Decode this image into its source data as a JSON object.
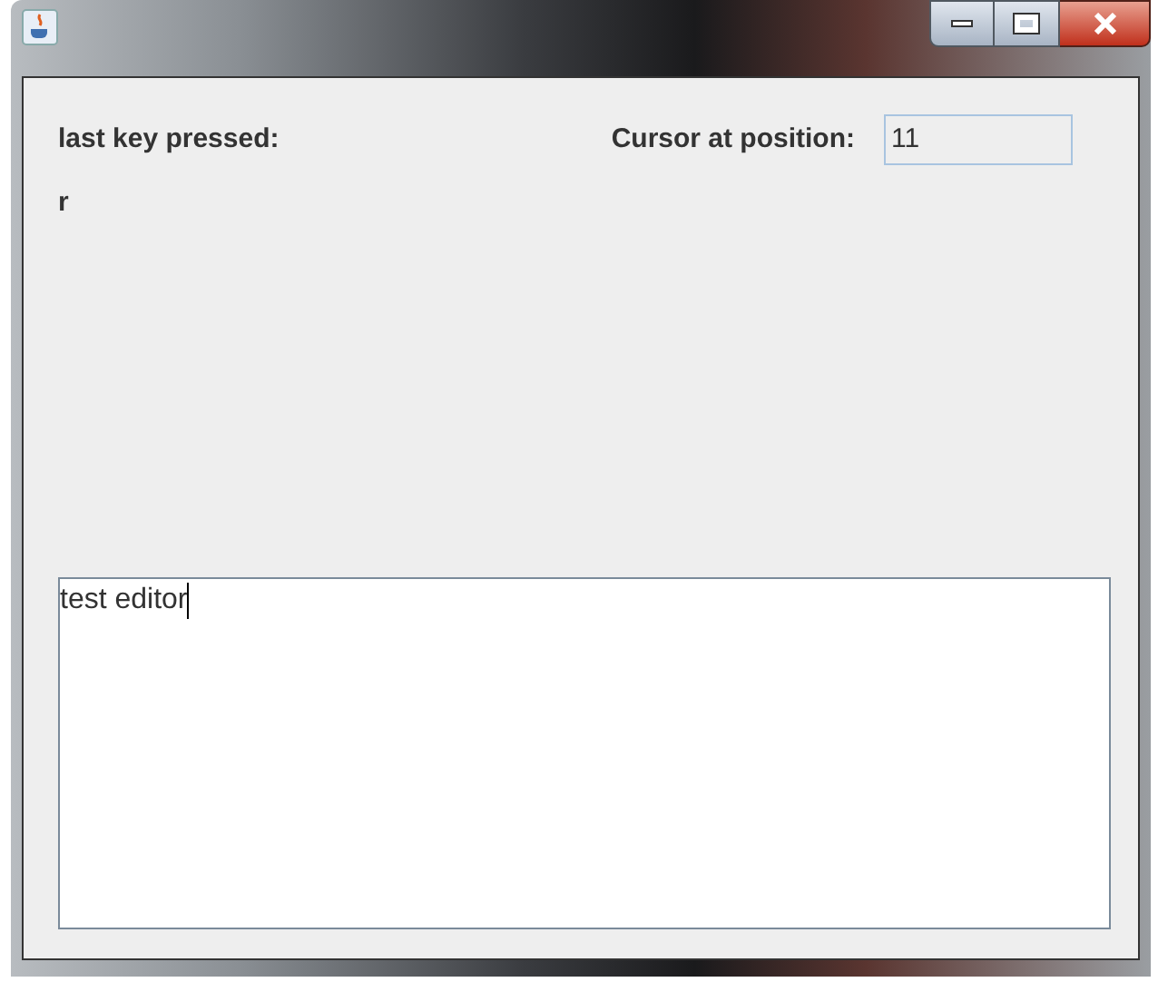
{
  "last_key": {
    "label": "last key pressed:",
    "value": "r"
  },
  "cursor": {
    "label": "Cursor at position:",
    "value": "11"
  },
  "editor": {
    "value": "test editor",
    "focused": true
  }
}
